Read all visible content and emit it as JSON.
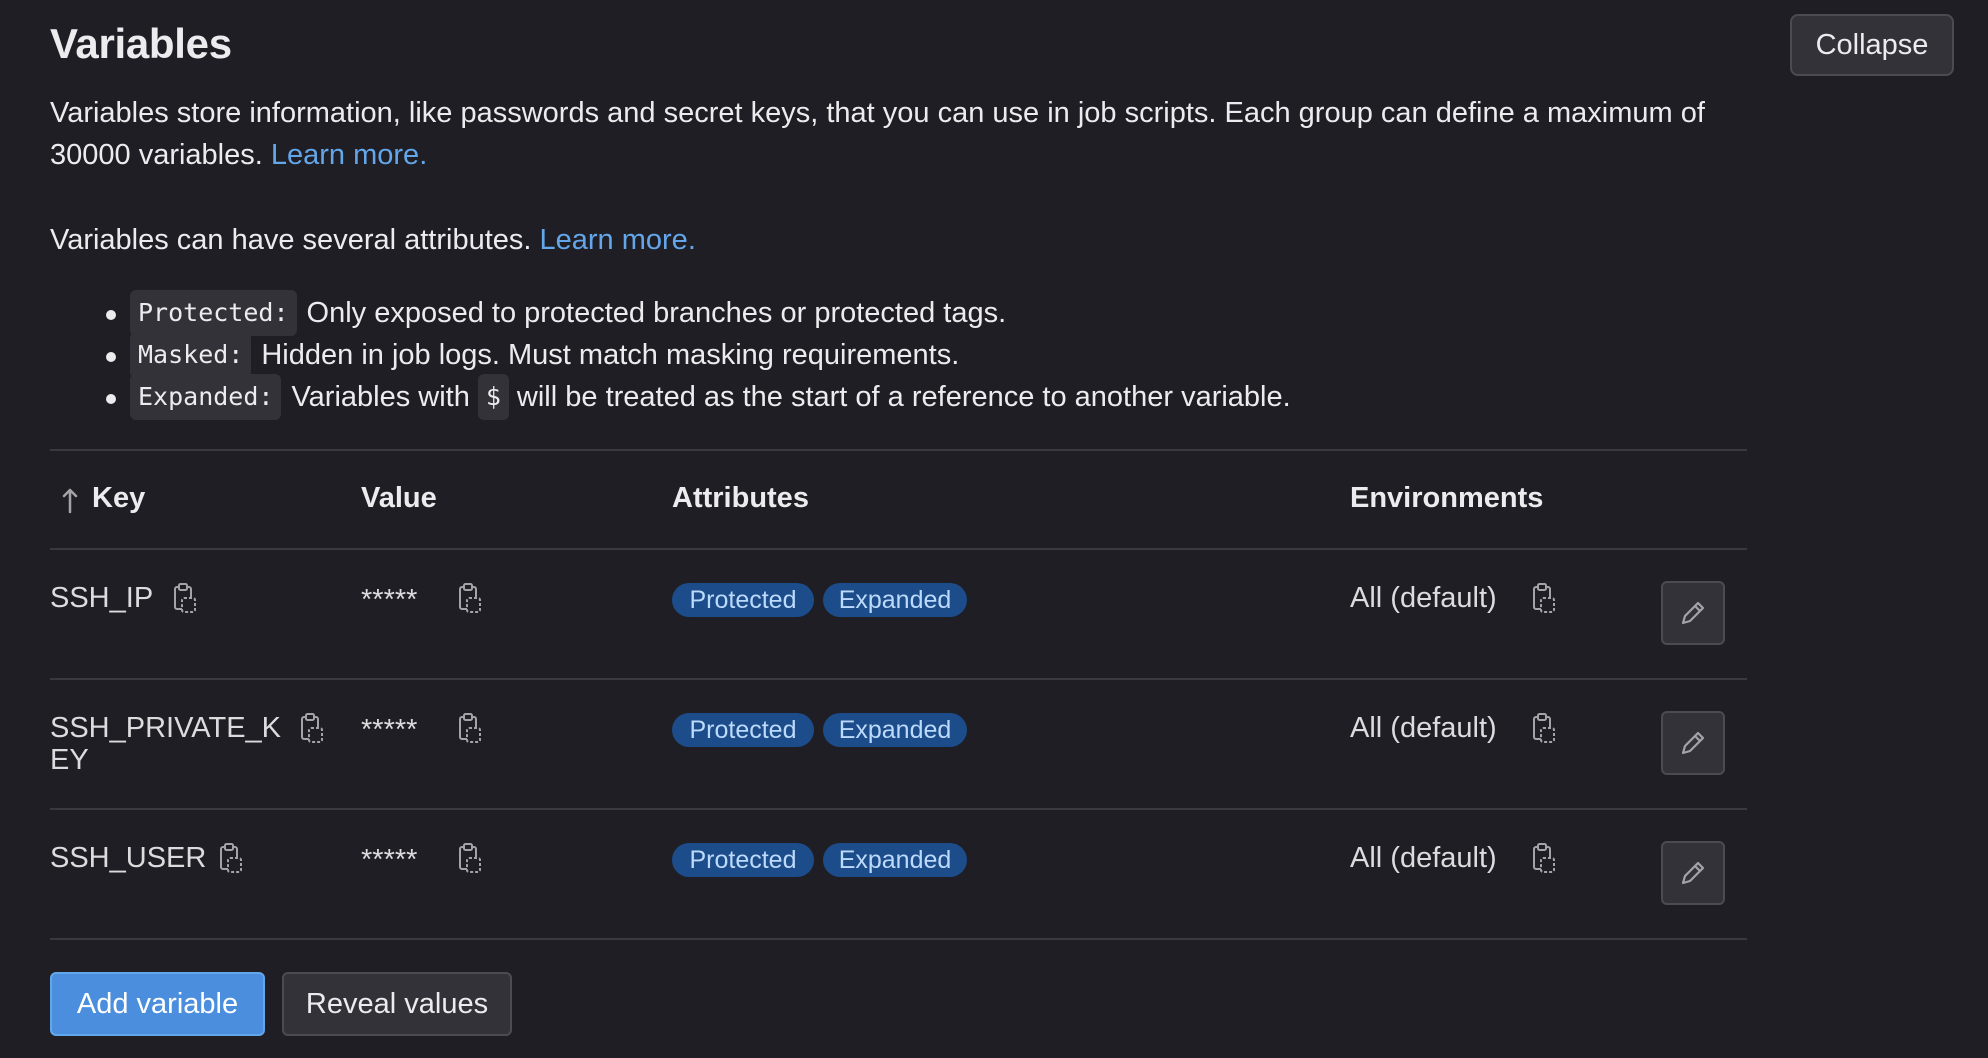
{
  "section": {
    "title": "Variables",
    "collapse_label": "Collapse",
    "description_text": "Variables store information, like passwords and secret keys, that you can use in job scripts. Each group can define a maximum of 30000 variables.",
    "description_link": "Learn more.",
    "attributes_intro": "Variables can have several attributes.",
    "attributes_link": "Learn more."
  },
  "attributes_list": [
    {
      "code": "Protected:",
      "text": "Only exposed to protected branches or protected tags."
    },
    {
      "code": "Masked:",
      "text": "Hidden in job logs. Must match masking requirements."
    },
    {
      "code": "Expanded:",
      "text_before": "Variables with",
      "inline_code": "$",
      "text_after": "will be treated as the start of a reference to another variable."
    }
  ],
  "table": {
    "headers": {
      "key": "Key",
      "value": "Value",
      "attributes": "Attributes",
      "environments": "Environments"
    },
    "sort_icon": "arrow-up-icon",
    "rows": [
      {
        "key_line1": "SSH_IP",
        "key_line2": "",
        "value": "*****",
        "badges": [
          "Protected",
          "Expanded"
        ],
        "environment": "All (default)"
      },
      {
        "key_line1": "SSH_PRIVATE_K",
        "key_line2": "EY",
        "value": "*****",
        "badges": [
          "Protected",
          "Expanded"
        ],
        "environment": "All (default)"
      },
      {
        "key_line1": "SSH_USER",
        "key_line2": "",
        "value": "*****",
        "badges": [
          "Protected",
          "Expanded"
        ],
        "environment": "All (default)"
      }
    ]
  },
  "actions": {
    "add_label": "Add variable",
    "reveal_label": "Reveal values"
  },
  "icons": {
    "copy": "copy-to-clipboard-icon",
    "edit": "pencil-icon"
  },
  "colors": {
    "background": "#1f1e24",
    "link": "#63a6e9",
    "badge_bg": "#1c4c8a",
    "badge_text": "#bcdafc",
    "primary_button": "#4b8ede"
  }
}
